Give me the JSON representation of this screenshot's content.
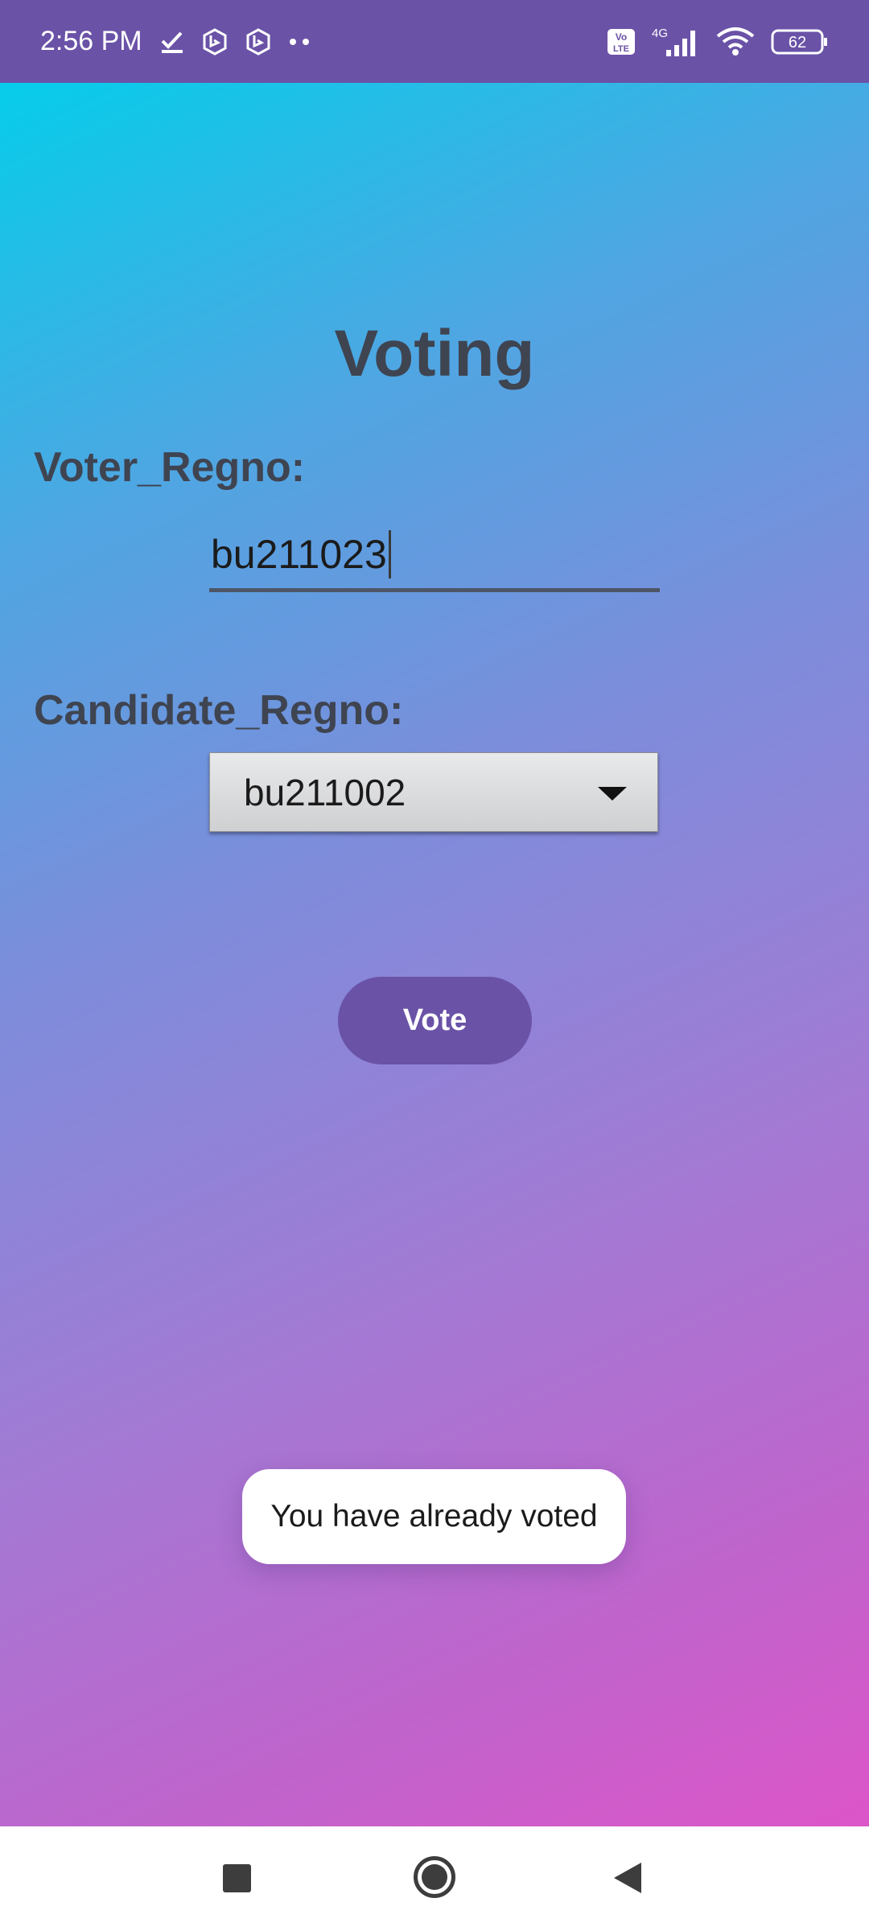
{
  "status_bar": {
    "time": "2:56 PM",
    "left_icons": [
      "check-download-icon",
      "bing-app-icon",
      "bing-app-icon",
      "more-dots-icon"
    ],
    "network_type": "4G",
    "volte_label": "Vo LTE",
    "battery_level": "62"
  },
  "app": {
    "title": "Voting",
    "voter_label": "Voter_Regno:",
    "voter_value": "bu211023",
    "candidate_label": "Candidate_Regno:",
    "candidate_selected": "bu211002",
    "vote_button": "Vote",
    "toast_message": "You have already voted"
  },
  "colors": {
    "primary": "#6a52a7",
    "text_dark": "#3f4451",
    "gradient_start": "#06cdea",
    "gradient_end": "#dc55c8"
  },
  "nav_bar": {
    "icons": [
      "recent-apps-icon",
      "home-icon",
      "back-icon"
    ]
  }
}
